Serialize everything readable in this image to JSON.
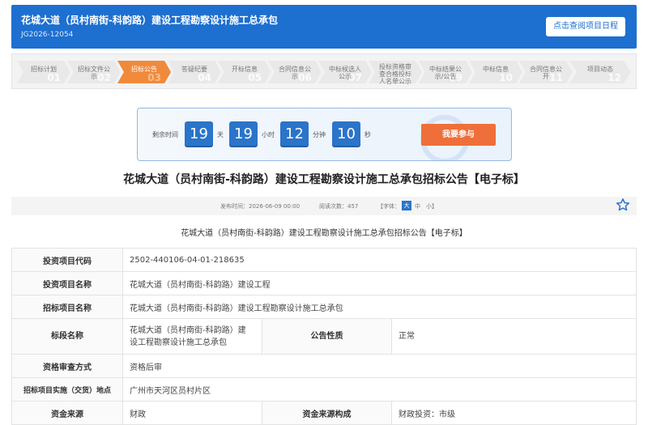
{
  "header": {
    "title": "花城大道（员村南街-科韵路）建设工程勘察设计施工总承包",
    "code": "JG2026-12054",
    "schedule_button": "点击查阅项目日程"
  },
  "steps": [
    {
      "label": "招标计划",
      "num": "01"
    },
    {
      "label": "招标文件公示",
      "num": "02"
    },
    {
      "label": "招标公告",
      "num": "03",
      "active": true
    },
    {
      "label": "答疑纪要",
      "num": "04"
    },
    {
      "label": "开标信息",
      "num": "05"
    },
    {
      "label": "合同信息公示",
      "num": "06"
    },
    {
      "label": "中标候选人公示",
      "num": "07"
    },
    {
      "label": "投标资格审查合格投标人名单公示",
      "num": "08"
    },
    {
      "label": "中标结果公示/公告",
      "num": "09"
    },
    {
      "label": "中标信息",
      "num": "10"
    },
    {
      "label": "合同信息公开",
      "num": "11"
    },
    {
      "label": "项目动态",
      "num": "12"
    }
  ],
  "countdown": {
    "label": "剩余时间",
    "days": "19",
    "days_unit": "天",
    "hours": "19",
    "hours_unit": "小时",
    "minutes": "12",
    "minutes_unit": "分钟",
    "seconds": "10",
    "seconds_unit": "秒",
    "join_button": "我要参与"
  },
  "page_title": "花城大道（员村南街-科韵路）建设工程勘察设计施工总承包招标公告【电子标】",
  "meta": {
    "publish_time": "发布时间：2026-06-09 00:00",
    "views": "阅读次数：457",
    "font_label": "【字体：",
    "font_big": "大",
    "font_mid": "中",
    "font_small": "小】"
  },
  "sub_title": "花城大道（员村南街-科韵路）建设工程勘察设计施工总承包招标公告【电子标】",
  "table": {
    "investment_code_label": "投资项目代码",
    "investment_code": "2502-440106-04-01-218635",
    "investment_name_label": "投资项目名称",
    "investment_name": "花城大道（员村南街-科韵路）建设工程",
    "bid_project_label": "招标项目名称",
    "bid_project": "花城大道（员村南街-科韵路）建设工程勘察设计施工总承包",
    "section_label": "标段名称",
    "section_line1": "花城大道（员村南街-科韵路）建",
    "section_line2": "设工程勘察设计施工总承包",
    "nature_label": "公告性质",
    "nature": "正常",
    "review_label": "资格审查方式",
    "review": "资格后审",
    "location_label": "招标项目实施（交货）地点",
    "location": "广州市天河区员村片区",
    "fund_label": "资金来源",
    "fund": "财政",
    "fund_comp_label": "资金来源构成",
    "fund_comp": "财政投资：市级"
  }
}
